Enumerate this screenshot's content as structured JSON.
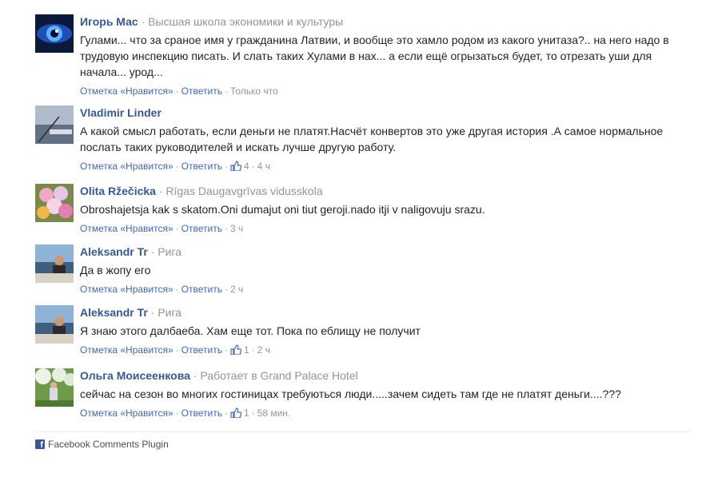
{
  "actions": {
    "like": "Отметка «Нравится»",
    "reply": "Ответить"
  },
  "comments": [
    {
      "author": "Игорь Мас",
      "meta": "Высшая школа экономики и культуры",
      "text": "Гулами... что за сраное имя у гражданина Латвии, и вообще это хамло родом из какого унитаза?.. на него надо в трудовую инспекцию писать. И слать таких Хулами в нах... а если ещё огрызаться будет, то отрезать уши для начала... урод...",
      "likes": "",
      "time": "Только что",
      "avatar": "blue-eye-photo"
    },
    {
      "author": "Vladimir Linder",
      "meta": "",
      "text": "А какой смысл работать, если деньги не платят.Насчёт конвертов это уже другая история .А самое нормальное послать таких руководителей и искать лучше другую работу.",
      "likes": "4",
      "time": "4 ч",
      "avatar": "sea-fishing-photo"
    },
    {
      "author": "Olita Ržečicka",
      "meta": "Rīgas Daugavgrīvas vidusskola",
      "text": "Obroshajetsja kak s skatom.Oni dumajut oni tiut geroji.nado itji v naligovuju srazu.",
      "likes": "",
      "time": "3 ч",
      "avatar": "flowers-photo"
    },
    {
      "author": "Aleksandr Tr",
      "meta": "Рига",
      "text": "Да в жопу его",
      "likes": "",
      "time": "2 ч",
      "avatar": "man-boat-photo"
    },
    {
      "author": "Aleksandr Tr",
      "meta": "Рига",
      "text": "Я знаю этого далбаеба. Хам еще тот. Пока по еблищу не получит",
      "likes": "1",
      "time": "2 ч",
      "avatar": "man-boat-photo"
    },
    {
      "author": "Ольга Моисеенкова",
      "meta": "Работает в Grand Palace Hotel",
      "text": "сейчас на сезон во многих гостиницах требуються люди.....зачем сидеть там где не платят деньги....???",
      "likes": "1",
      "time": "58 мин.",
      "avatar": "garden-photo"
    }
  ],
  "footer": {
    "label": "Facebook Comments Plugin"
  },
  "colors": {
    "name": "#365899",
    "link": "#4267b2",
    "muted": "#90949c",
    "text": "#1d2129"
  }
}
